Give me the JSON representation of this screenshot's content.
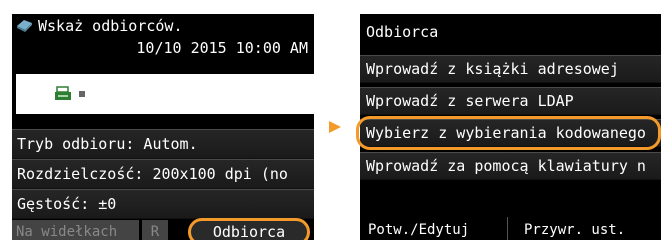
{
  "left_screen": {
    "title": "Wskaż odbiorców.",
    "datetime": "10/10 2015 10:00 AM",
    "settings": [
      "Tryb odbioru: Autom.",
      "Rozdzielczość: 200x100 dpi (no",
      "Gęstość: ±0"
    ],
    "bottom": {
      "hook_label": "Na widełkach",
      "r_label": "R",
      "recipient_label": "Odbiorca"
    }
  },
  "right_screen": {
    "title": "Odbiorca",
    "items": [
      "Wprowadź z książki adresowej",
      "Wprowadź z serwera LDAP",
      "Wybierz z wybierania kodowanego",
      "Wprowadź za pomocą klawiatury n"
    ],
    "bottom": {
      "edit_label": "Potw./Edytuj",
      "settings_label": "Przywr. ust."
    }
  },
  "colors": {
    "highlight": "#f39a2a",
    "screen_bg": "#000000"
  },
  "icons": {
    "title_icon": "recipients-icon",
    "input_icon": "fax-icon",
    "pointer": "arrow-right-icon"
  }
}
